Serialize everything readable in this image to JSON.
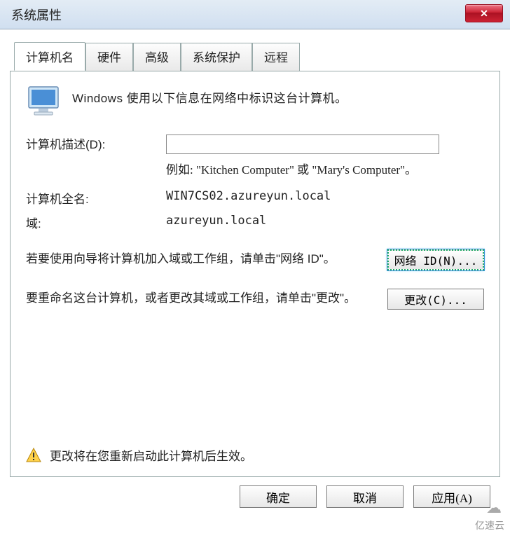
{
  "title": "系统属性",
  "close_x": "✕",
  "tabs": {
    "t0": "计算机名",
    "t1": "硬件",
    "t2": "高级",
    "t3": "系统保护",
    "t4": "远程"
  },
  "intro": "Windows 使用以下信息在网络中标识这台计算机。",
  "desc_label": "计算机描述(D):",
  "desc_value": "",
  "desc_hint": "例如: \"Kitchen Computer\" 或 \"Mary's Computer\"。",
  "fullname_label": "计算机全名:",
  "fullname_value": "WIN7CS02.azureyun.local",
  "domain_label": "域:",
  "domain_value": "azureyun.local",
  "netid_text": "若要使用向导将计算机加入域或工作组，请单击\"网络 ID\"。",
  "netid_btn": "网络 ID(N)...",
  "change_text": "要重命名这台计算机，或者更改其域或工作组，请单击\"更改\"。",
  "change_btn": "更改(C)...",
  "warn_text": "更改将在您重新启动此计算机后生效。",
  "ok_btn": "确定",
  "cancel_btn": "取消",
  "apply_btn": "应用(A)",
  "watermark": "亿速云"
}
